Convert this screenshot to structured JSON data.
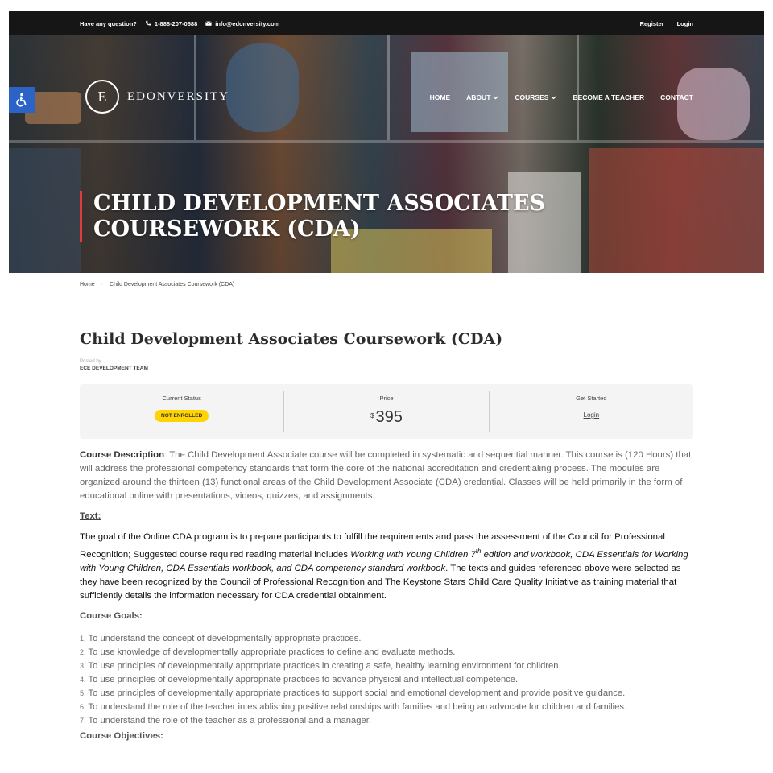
{
  "topbar": {
    "question": "Have any question?",
    "phone": "1-888-207-0688",
    "email": "info@edonversity.com",
    "register": "Register",
    "login": "Login"
  },
  "header": {
    "logo_letter": "E",
    "logo_text": "EDONVERSITY",
    "nav": [
      {
        "label": "HOME",
        "dropdown": false
      },
      {
        "label": "ABOUT",
        "dropdown": true
      },
      {
        "label": "COURSES",
        "dropdown": true
      },
      {
        "label": "BECOME A TEACHER",
        "dropdown": false
      },
      {
        "label": "CONTACT",
        "dropdown": false
      }
    ]
  },
  "hero": {
    "title_line1": "CHILD DEVELOPMENT ASSOCIATES",
    "title_line2": "COURSEWORK (CDA)"
  },
  "breadcrumb": {
    "home": "Home",
    "current": "Child Development Associates Coursework (CDA)"
  },
  "course": {
    "title": "Child Development Associates Coursework (CDA)",
    "posted_by_label": "Posted by",
    "author": "ECE DEVELOPMENT TEAM",
    "status_label": "Current Status",
    "status_value": "NOT ENROLLED",
    "price_label": "Price",
    "price_currency": "$",
    "price_amount": "395",
    "get_started_label": "Get Started",
    "get_started_link": "Login"
  },
  "body": {
    "desc_label": "Course Description",
    "desc_text": ": The Child Development Associate course will be completed in systematic and sequential manner. This course is (120 Hours) that will address the professional competency standards that form the core of the national accreditation and credentialing process. The modules are organized around the thirteen (13) functional areas of the Child Development Associate (CDA) credential. Classes will be held primarily in the form of educational online with presentations, videos, quizzes, and assignments.",
    "text_label": "Text:",
    "goal_part1": "The goal of the Online CDA program is to prepare participants to fulfill the requirements and pass the assessment of the Council for Professional Recognition; Suggested course required reading material includes ",
    "goal_italic1": "Working with Young Children 7",
    "goal_sup": "th",
    "goal_italic2": " edition and workbook, CDA Essentials for Working with Young Children, CDA Essentials workbook, and CDA competency standard workbook",
    "goal_part2": ". The texts and guides referenced above were selected as they have been recognized by the Council of Professional Recognition and The Keystone Stars Child Care Quality Initiative as training material that sufficiently details the information necessary for CDA credential obtainment.",
    "goals_label": "Course Goals:",
    "goals": [
      "To understand the concept of developmentally appropriate practices.",
      "To use knowledge of developmentally appropriate practices to define and evaluate methods.",
      "To use principles of developmentally appropriate practices in creating a safe, healthy learning environment for children.",
      "To use principles of developmentally appropriate practices to advance physical and intellectual competence.",
      "To use principles of developmentally appropriate practices to support social and emotional development and provide positive guidance.",
      "To understand the role of the teacher in establishing positive relationships with families and being an advocate for children and families.",
      "To understand the role of the teacher as a professional and a manager."
    ],
    "goal_numbers": [
      "1.",
      "2.",
      "3.",
      "4.",
      "5.",
      "6.",
      "7."
    ],
    "objectives_label": "Course Objectives:"
  },
  "colors": {
    "topbar_bg": "#161616",
    "badge": "#ffd400",
    "accessibility": "#2b64c6",
    "hero_accent": "#e03c3c"
  }
}
